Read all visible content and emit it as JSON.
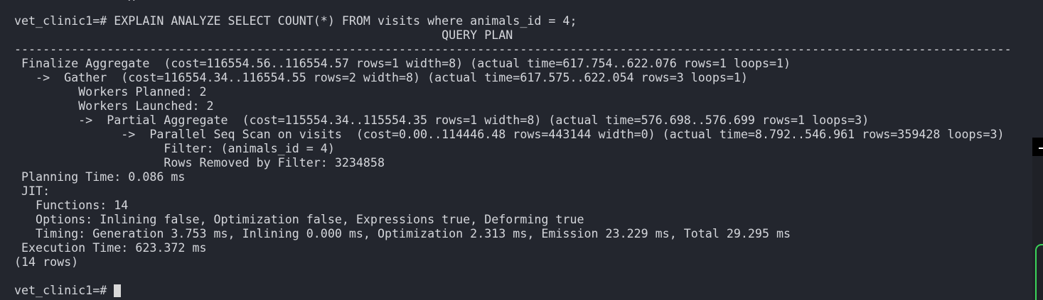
{
  "terminal": {
    "caret_mark": "^",
    "prompt_line": "vet_clinic1=# EXPLAIN ANALYZE SELECT COUNT(*) FROM visits where animals_id = 4;",
    "header": "                                                            QUERY PLAN",
    "separator": "--------------------------------------------------------------------------------------------------------------------------------------------",
    "plan_lines": [
      " Finalize Aggregate  (cost=116554.56..116554.57 rows=1 width=8) (actual time=617.754..622.076 rows=1 loops=1)",
      "   ->  Gather  (cost=116554.34..116554.55 rows=2 width=8) (actual time=617.575..622.054 rows=3 loops=1)",
      "         Workers Planned: 2",
      "         Workers Launched: 2",
      "         ->  Partial Aggregate  (cost=115554.34..115554.35 rows=1 width=8) (actual time=576.698..576.699 rows=1 loops=3)",
      "               ->  Parallel Seq Scan on visits  (cost=0.00..114446.48 rows=443144 width=0) (actual time=8.792..546.961 rows=359428 loops=3)",
      "                     Filter: (animals_id = 4)",
      "                     Rows Removed by Filter: 3234858",
      " Planning Time: 0.086 ms",
      " JIT:",
      "   Functions: 14",
      "   Options: Inlining false, Optimization false, Expressions true, Deforming true",
      "   Timing: Generation 3.753 ms, Inlining 0.000 ms, Optimization 2.313 ms, Emission 23.229 ms, Total 29.295 ms",
      " Execution Time: 623.372 ms"
    ],
    "row_count": "(14 rows)",
    "final_prompt": "vet_clinic1=# "
  },
  "colors": {
    "background": "#23262e",
    "text": "#d4d6db",
    "cursor": "#d8d8d8",
    "accent": "#3bd45a"
  }
}
